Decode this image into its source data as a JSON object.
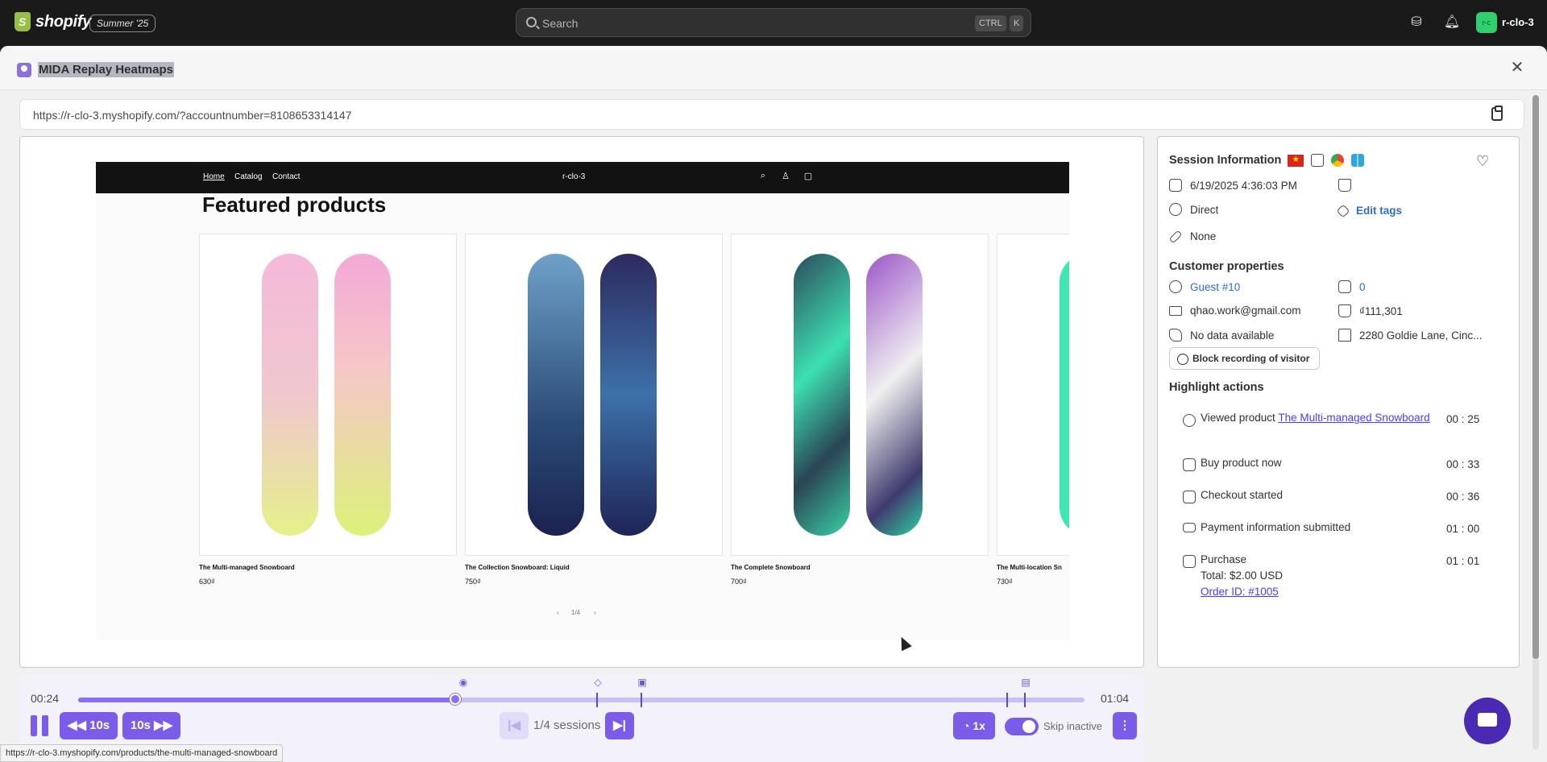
{
  "topbar": {
    "logo_text": "shopify",
    "edition": "Summer '25",
    "search_placeholder": "Search",
    "kbd1": "CTRL",
    "kbd2": "K",
    "avatar_initials": "r-c",
    "store_name": "r-clo-3"
  },
  "modal": {
    "title": "MIDA Replay Heatmaps",
    "url": "https://r-clo-3.myshopify.com/?accountnumber=8108653314147"
  },
  "site": {
    "nav": [
      "Home",
      "Catalog",
      "Contact"
    ],
    "store_name": "r-clo-3",
    "heading": "Featured products",
    "products": [
      {
        "name": "The Multi-managed Snowboard",
        "price": "630₫"
      },
      {
        "name": "The Collection Snowboard: Liquid",
        "price": "750₫"
      },
      {
        "name": "The Complete Snowboard",
        "price": "700₫"
      },
      {
        "name": "The Multi-location Sn",
        "price": "730₫"
      }
    ],
    "pager": "1/4"
  },
  "session": {
    "title": "Session Information",
    "datetime": "6/19/2025 4:36:03 PM",
    "source": "Direct",
    "referrer": "None",
    "edit_tags": "Edit tags",
    "customer_title": "Customer properties",
    "guest": "Guest #10",
    "orders": "0",
    "email": "qhao.work@gmail.com",
    "spent": "₫111,301",
    "phone": "No data available",
    "address": "2280 Goldie Lane, Cinc...",
    "block_button": "Block recording of visitor",
    "highlight_title": "Highlight actions",
    "actions": [
      {
        "label": "Viewed product ",
        "link": "The Multi-managed Snowboard",
        "time": "00 : 25"
      },
      {
        "label": "Buy product now",
        "time": "00 : 33"
      },
      {
        "label": "Checkout started",
        "time": "00 : 36"
      },
      {
        "label": "Payment information submitted",
        "time": "01 : 00"
      },
      {
        "label": "Purchase",
        "line2": "Total: $2.00 USD",
        "link": "Order ID: #1005",
        "time": "01 : 01"
      }
    ]
  },
  "player": {
    "current_time": "00:24",
    "total_time": "01:04",
    "progress_fraction": 0.375,
    "back_label": "10s",
    "fwd_label": "10s",
    "sessions": "1/4 sessions",
    "speed": "1x",
    "skip_inactive": "Skip inactive",
    "skip_inactive_on": true
  },
  "status_url": "https://r-clo-3.myshopify.com/products/the-multi-managed-snowboard",
  "colors": {
    "accent": "#7b5ce8",
    "link": "#2c6ecb",
    "topbar": "#1a1a1a"
  }
}
